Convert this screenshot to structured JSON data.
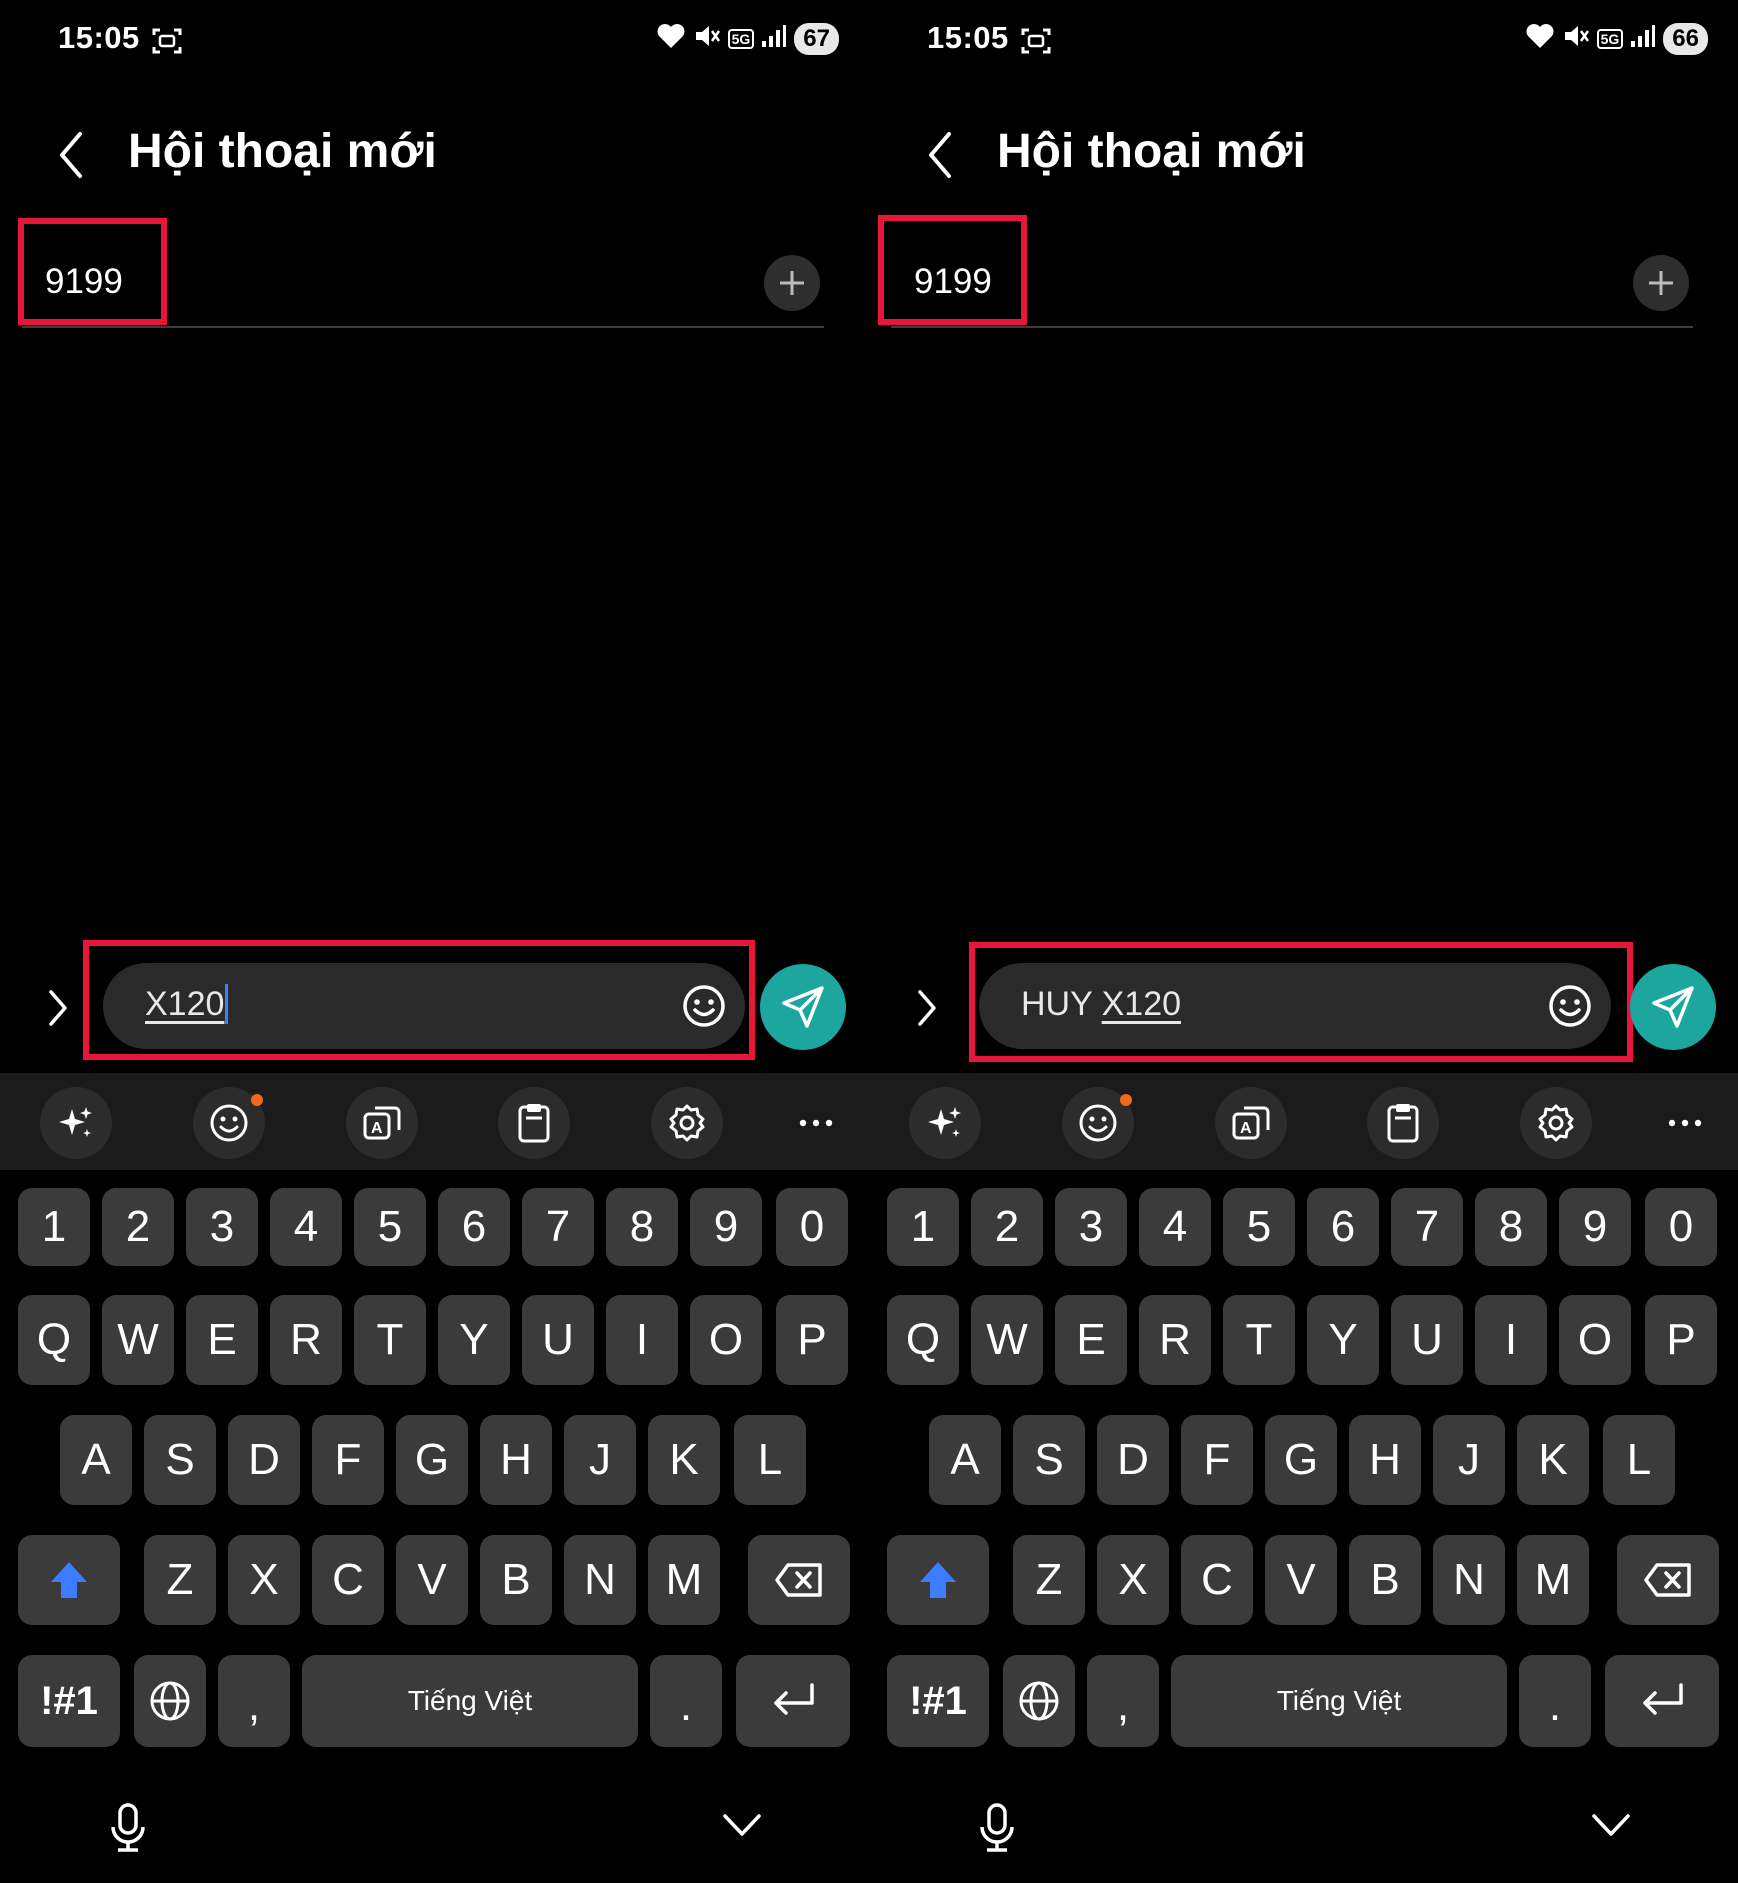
{
  "screens": [
    {
      "status": {
        "time": "15:05",
        "battery": "67",
        "network": "5G"
      },
      "header": {
        "title": "Hội thoại mới"
      },
      "recipient": {
        "value": "9199"
      },
      "composer": {
        "text_prefix": "",
        "text_underlined": "X120",
        "cursor_visible": true
      },
      "keyboard": {
        "space_label": "Tiếng Việt"
      }
    },
    {
      "status": {
        "time": "15:05",
        "battery": "66",
        "network": "5G"
      },
      "header": {
        "title": "Hội thoại mới"
      },
      "recipient": {
        "value": "9199"
      },
      "composer": {
        "text_prefix": "HUY ",
        "text_underlined": "X120",
        "cursor_visible": false
      },
      "keyboard": {
        "space_label": "Tiếng Việt"
      }
    }
  ],
  "keyboard": {
    "number_row": [
      "1",
      "2",
      "3",
      "4",
      "5",
      "6",
      "7",
      "8",
      "9",
      "0"
    ],
    "row1": [
      "Q",
      "W",
      "E",
      "R",
      "T",
      "Y",
      "U",
      "I",
      "O",
      "P"
    ],
    "row2": [
      "A",
      "S",
      "D",
      "F",
      "G",
      "H",
      "J",
      "K",
      "L"
    ],
    "row3": [
      "Z",
      "X",
      "C",
      "V",
      "B",
      "N",
      "M"
    ],
    "symbols_label": "!#1",
    "comma": ",",
    "period": ".",
    "toolbar_icons": [
      "ai-sparkle-icon",
      "emoji-icon",
      "translate-icon",
      "clipboard-icon",
      "settings-icon",
      "more-icon"
    ],
    "bottom_icons": [
      "microphone-icon",
      "hide-keyboard-icon"
    ]
  },
  "colors": {
    "background": "#000000",
    "key": "#3b3b3b",
    "toolbar": "#1b1b1b",
    "send_button": "#1ca69e",
    "shift_active": "#3d7cff",
    "highlight_box": "#e8173a",
    "notification_dot": "#f06a1c"
  }
}
